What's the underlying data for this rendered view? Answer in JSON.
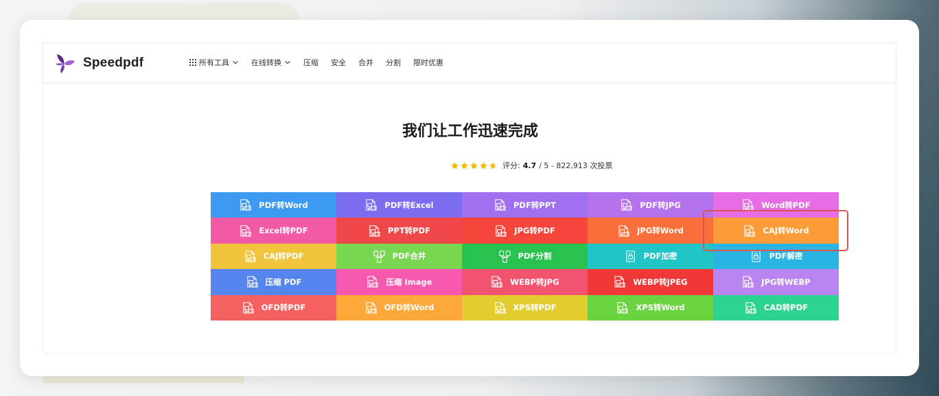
{
  "brand": {
    "name": "Speedpdf"
  },
  "nav": [
    {
      "label": "所有工具",
      "icon": "grid-icon",
      "dropdown": true
    },
    {
      "label": "在线转换",
      "dropdown": true
    },
    {
      "label": "压缩",
      "dropdown": false
    },
    {
      "label": "安全",
      "dropdown": false
    },
    {
      "label": "合并",
      "dropdown": false
    },
    {
      "label": "分割",
      "dropdown": false
    },
    {
      "label": "限时优惠",
      "dropdown": false
    }
  ],
  "hero": {
    "title": "我们让工作迅速完成"
  },
  "rating": {
    "label": "评分:",
    "score": "4.7",
    "suffix": "/ 5 - 822,913 次投票",
    "stars_value": 4.7,
    "stars_max": 5,
    "star_color": "#f5b800"
  },
  "tools": [
    {
      "label": "PDF转Word",
      "color": "#3d9af0",
      "icon": "pdf-to-word-icon"
    },
    {
      "label": "PDF转Excel",
      "color": "#7b6cf0",
      "icon": "pdf-to-excel-icon"
    },
    {
      "label": "PDF转PPT",
      "color": "#a070f0",
      "icon": "pdf-to-ppt-icon"
    },
    {
      "label": "PDF转JPG",
      "color": "#b472ec",
      "icon": "pdf-to-jpg-icon"
    },
    {
      "label": "Word转PDF",
      "color": "#e66de6",
      "icon": "word-to-pdf-icon"
    },
    {
      "label": "Excel转PDF",
      "color": "#f25aa6",
      "icon": "excel-to-pdf-icon"
    },
    {
      "label": "PPT转PDF",
      "color": "#f04848",
      "icon": "ppt-to-pdf-icon"
    },
    {
      "label": "JPG转PDF",
      "color": "#f5443a",
      "icon": "jpg-to-pdf-icon"
    },
    {
      "label": "JPG转Word",
      "color": "#fa6e3a",
      "icon": "jpg-to-word-icon"
    },
    {
      "label": "CAJ转Word",
      "color": "#fb9c38",
      "icon": "caj-to-word-icon"
    },
    {
      "label": "CAJ转PDF",
      "color": "#f0c43c",
      "icon": "caj-to-pdf-icon"
    },
    {
      "label": "PDF合并",
      "color": "#78d650",
      "icon": "pdf-merge-icon"
    },
    {
      "label": "PDF分割",
      "color": "#28c24e",
      "icon": "pdf-split-icon"
    },
    {
      "label": "PDF加密",
      "color": "#20c6c6",
      "icon": "pdf-encrypt-icon"
    },
    {
      "label": "PDF解密",
      "color": "#2ab4e4",
      "icon": "pdf-decrypt-icon"
    },
    {
      "label": "压缩 PDF",
      "color": "#5584ec",
      "icon": "compress-pdf-icon"
    },
    {
      "label": "压缩 Image",
      "color": "#f658ae",
      "icon": "compress-image-icon"
    },
    {
      "label": "WEBP转JPG",
      "color": "#f25470",
      "icon": "webp-to-jpg-icon"
    },
    {
      "label": "WEBP转JPEG",
      "color": "#f03838",
      "icon": "webp-to-jpeg-icon"
    },
    {
      "label": "JPG转WEBP",
      "color": "#b884f0",
      "icon": "jpg-to-webp-icon"
    },
    {
      "label": "OFD转PDF",
      "color": "#f56060",
      "icon": "ofd-to-pdf-icon"
    },
    {
      "label": "OFD转Word",
      "color": "#fca83a",
      "icon": "ofd-to-word-icon"
    },
    {
      "label": "XPS转PDF",
      "color": "#e2cc30",
      "icon": "xps-to-pdf-icon"
    },
    {
      "label": "XPS转Word",
      "color": "#6ad440",
      "icon": "xps-to-word-icon"
    },
    {
      "label": "CAD转PDF",
      "color": "#2cd490",
      "icon": "cad-to-pdf-icon"
    }
  ],
  "highlight": {
    "target": "CAJ转Word",
    "color": "#d9534f"
  }
}
